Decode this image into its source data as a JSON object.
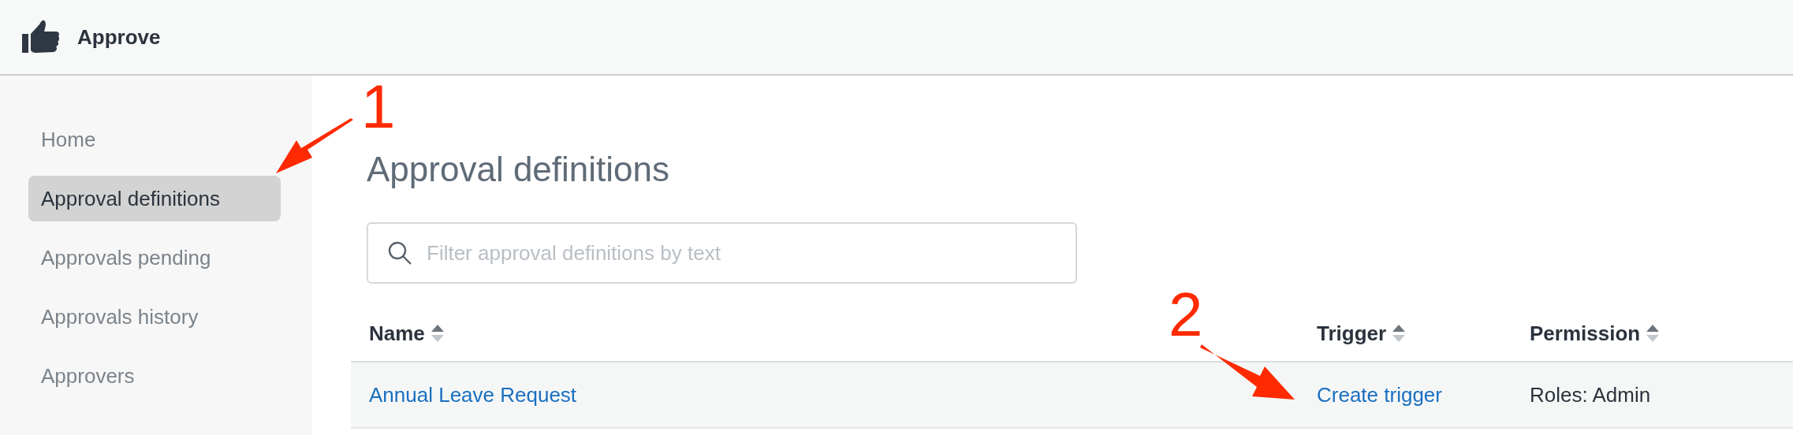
{
  "header": {
    "app_name": "Approve"
  },
  "sidebar": {
    "items": [
      {
        "label": "Home",
        "selected": false
      },
      {
        "label": "Approval definitions",
        "selected": true
      },
      {
        "label": "Approvals pending",
        "selected": false
      },
      {
        "label": "Approvals history",
        "selected": false
      },
      {
        "label": "Approvers",
        "selected": false
      }
    ]
  },
  "page": {
    "title": "Approval definitions",
    "search": {
      "placeholder": "Filter approval definitions by text"
    }
  },
  "table": {
    "columns": [
      "Name",
      "Trigger",
      "Permission"
    ],
    "rows": [
      {
        "name": "Annual Leave Request",
        "trigger": "Create trigger",
        "permission": "Roles: Admin"
      }
    ]
  },
  "annotations": [
    {
      "label": "1"
    },
    {
      "label": "2"
    }
  ]
}
